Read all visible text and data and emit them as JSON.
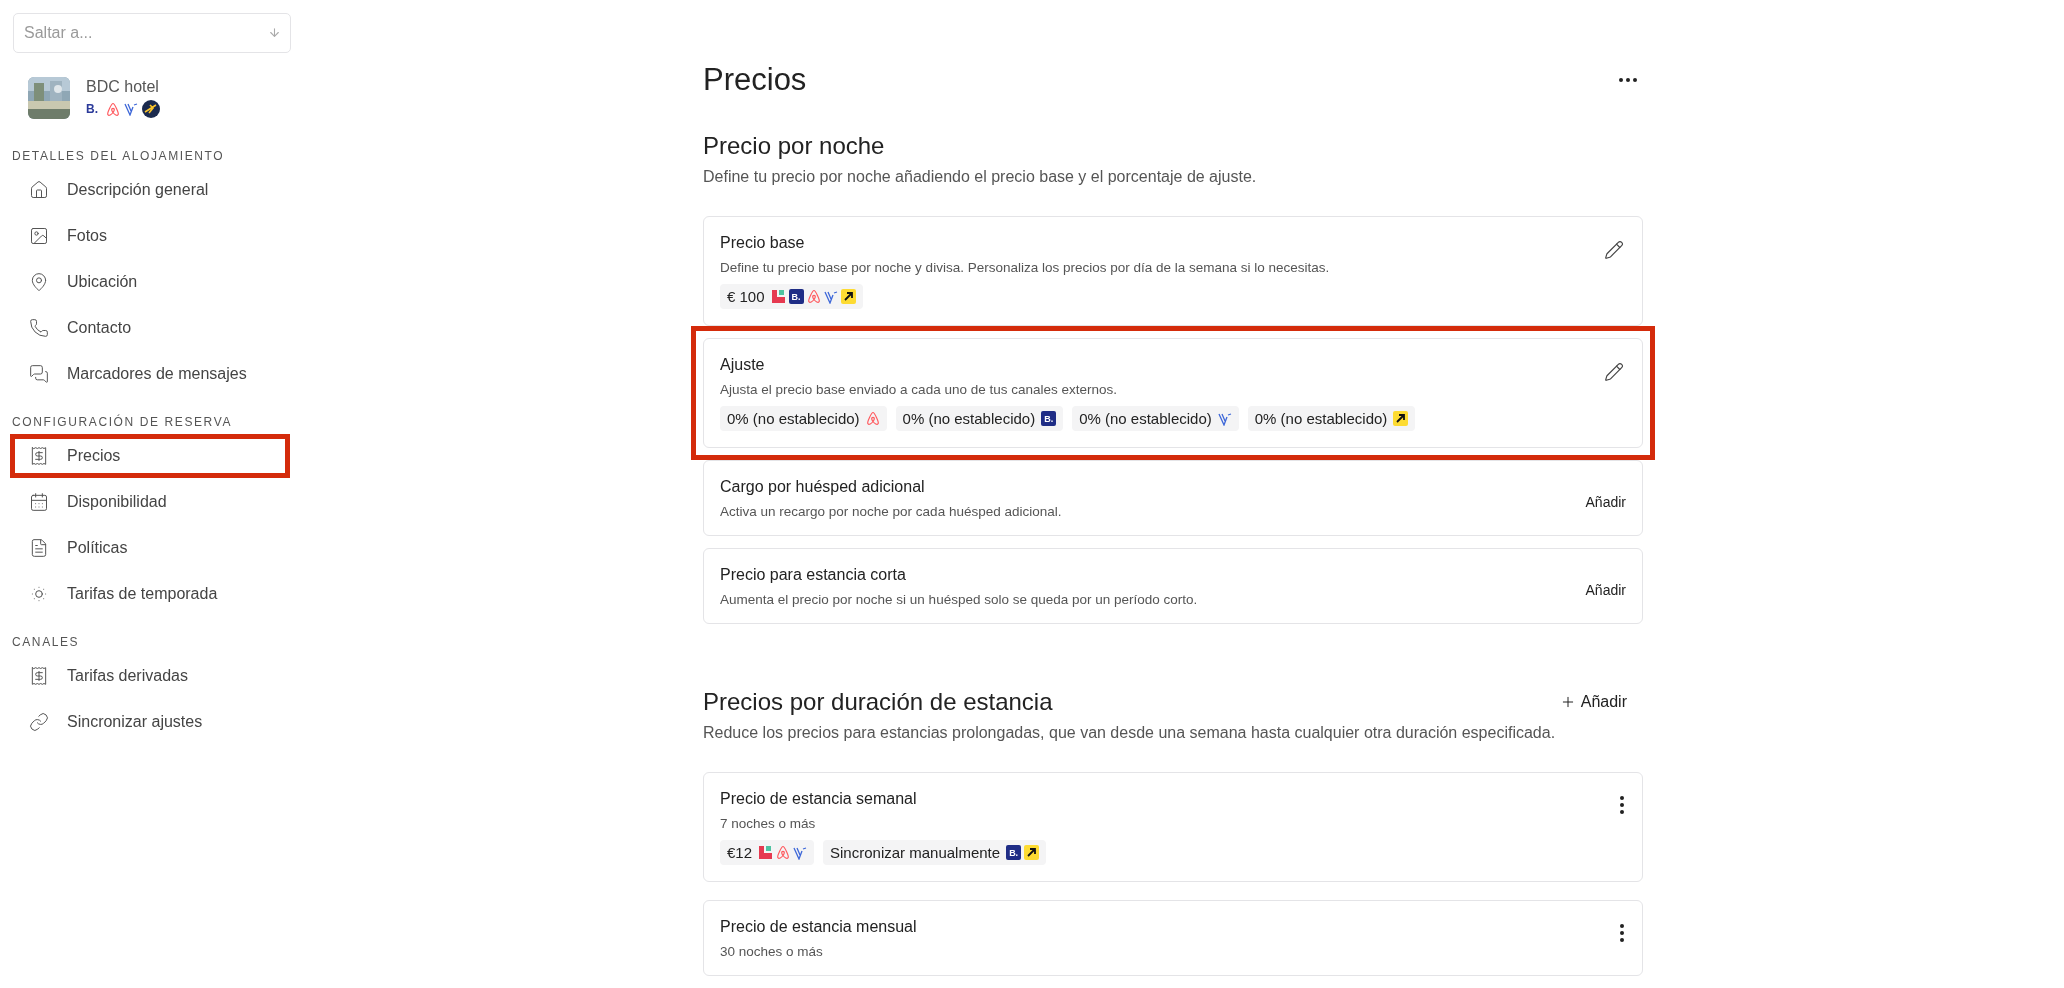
{
  "jump": {
    "placeholder": "Saltar a..."
  },
  "hotel": {
    "name": "BDC hotel",
    "channels": [
      {
        "kind": "booking-text",
        "mark": "B."
      },
      {
        "kind": "airbnb"
      },
      {
        "kind": "vrbo"
      },
      {
        "kind": "expedia-round"
      }
    ]
  },
  "sidebar": {
    "sections": [
      {
        "title": "DETALLES DEL ALOJAMIENTO",
        "items": [
          {
            "label": "Descripción general",
            "kind": "home",
            "highlighted": false
          },
          {
            "label": "Fotos",
            "highlighted": false
          },
          {
            "label": "Ubicación",
            "kind": "pin",
            "highlighted": false
          },
          {
            "label": "Contacto",
            "kind": "phone",
            "highlighted": false
          },
          {
            "label": "Marcadores de mensajes",
            "kind": "chat",
            "highlighted": false
          }
        ]
      },
      {
        "title": "CONFIGURACIÓN DE RESERVA",
        "items": [
          {
            "label": "Precios",
            "kind": "receipt",
            "highlighted": true
          },
          {
            "label": "Disponibilidad",
            "kind": "calendar",
            "highlighted": false
          },
          {
            "label": "Políticas",
            "kind": "document",
            "highlighted": false
          },
          {
            "label": "Tarifas de temporada",
            "kind": "sun",
            "highlighted": false
          }
        ]
      },
      {
        "title": "CANALES",
        "items": [
          {
            "label": "Tarifas derivadas",
            "kind": "receipt",
            "highlighted": false
          },
          {
            "label": "Sincronizar ajustes",
            "kind": "link",
            "highlighted": false
          }
        ]
      }
    ]
  },
  "page": {
    "title": "Precios",
    "sections": [
      {
        "title": "Precio por noche",
        "description": "Define tu precio por noche añadiendo el precio base y el porcentaje de ajuste.",
        "cards": [
          {
            "title": "Precio base",
            "description": "Define tu precio base por noche y divisa. Personaliza los precios por día de la semana si lo necesitas.",
            "action": {
              "kind": "edit"
            },
            "highlighted": false,
            "chips": [
              {
                "text": "€ 100",
                "channels": [
                  {
                    "kind": "hostaway"
                  },
                  {
                    "kind": "booking",
                    "mark": "B."
                  },
                  {
                    "kind": "airbnb"
                  },
                  {
                    "kind": "vrbo"
                  },
                  {
                    "kind": "expedia"
                  }
                ]
              }
            ]
          },
          {
            "title": "Ajuste",
            "description": "Ajusta el precio base enviado a cada uno de tus canales externos.",
            "action": {
              "kind": "edit"
            },
            "highlighted": true,
            "chips": [
              {
                "text": "0% (no establecido)",
                "channels": [
                  {
                    "kind": "airbnb"
                  }
                ]
              },
              {
                "text": "0% (no establecido)",
                "channels": [
                  {
                    "kind": "booking",
                    "mark": "B."
                  }
                ]
              },
              {
                "text": "0% (no establecido)",
                "channels": [
                  {
                    "kind": "vrbo"
                  }
                ]
              },
              {
                "text": "0% (no establecido)",
                "channels": [
                  {
                    "kind": "expedia"
                  }
                ]
              }
            ]
          },
          {
            "title": "Cargo por huésped adicional",
            "description": "Activa un recargo por noche por cada huésped adicional.",
            "action": {
              "kind": "text",
              "label": "Añadir"
            },
            "highlighted": false
          },
          {
            "title": "Precio para estancia corta",
            "description": "Aumenta el precio por noche si un huésped solo se queda por un período corto.",
            "action": {
              "kind": "text",
              "label": "Añadir"
            },
            "highlighted": false
          }
        ]
      },
      {
        "title": "Precios por duración de estancia",
        "description": "Reduce los precios para estancias prolongadas, que van desde una semana hasta cualquier otra duración especificada.",
        "action": {
          "kind": "add",
          "label": "Añadir"
        },
        "cards": [
          {
            "title": "Precio de estancia semanal",
            "description": "7 noches o más",
            "action": {
              "kind": "more"
            },
            "highlighted": false,
            "chips": [
              {
                "text": "€12",
                "channels": [
                  {
                    "kind": "hostaway"
                  },
                  {
                    "kind": "airbnb"
                  },
                  {
                    "kind": "vrbo"
                  }
                ]
              },
              {
                "text": "Sincronizar manualmente",
                "channels": [
                  {
                    "kind": "booking",
                    "mark": "B."
                  },
                  {
                    "kind": "expedia"
                  }
                ]
              }
            ]
          },
          {
            "title": "Precio de estancia mensual",
            "description": "30 noches o más",
            "action": {
              "kind": "more"
            },
            "highlighted": false
          }
        ]
      }
    ]
  }
}
